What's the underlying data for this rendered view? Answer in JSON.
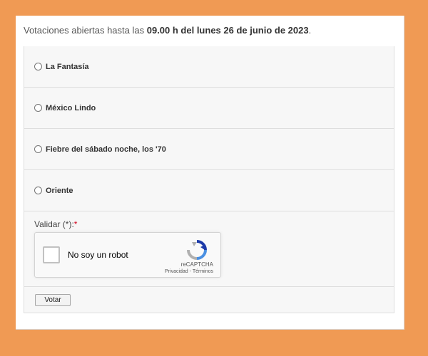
{
  "poll": {
    "intro_text": "Votaciones abiertas hasta las ",
    "deadline": "09.00 h del lunes 26 de junio de 2023",
    "intro_end": ".",
    "options": [
      {
        "label": "La Fantasía",
        "selected": false
      },
      {
        "label": "México Lindo",
        "selected": false
      },
      {
        "label": "Fiebre del sábado noche, los '70",
        "selected": false
      },
      {
        "label": "Oriente",
        "selected": false
      }
    ],
    "validate_label": "Validar (*):",
    "required_mark": "*",
    "submit_label": "Votar"
  },
  "captcha": {
    "checkbox_label": "No soy un robot",
    "brand": "reCAPTCHA",
    "privacy": "Privacidad",
    "separator": " - ",
    "terms": "Términos",
    "colors": {
      "blue": "#4a90e2",
      "dark_blue": "#1c3aa9",
      "gray": "#b0b0b0"
    }
  }
}
